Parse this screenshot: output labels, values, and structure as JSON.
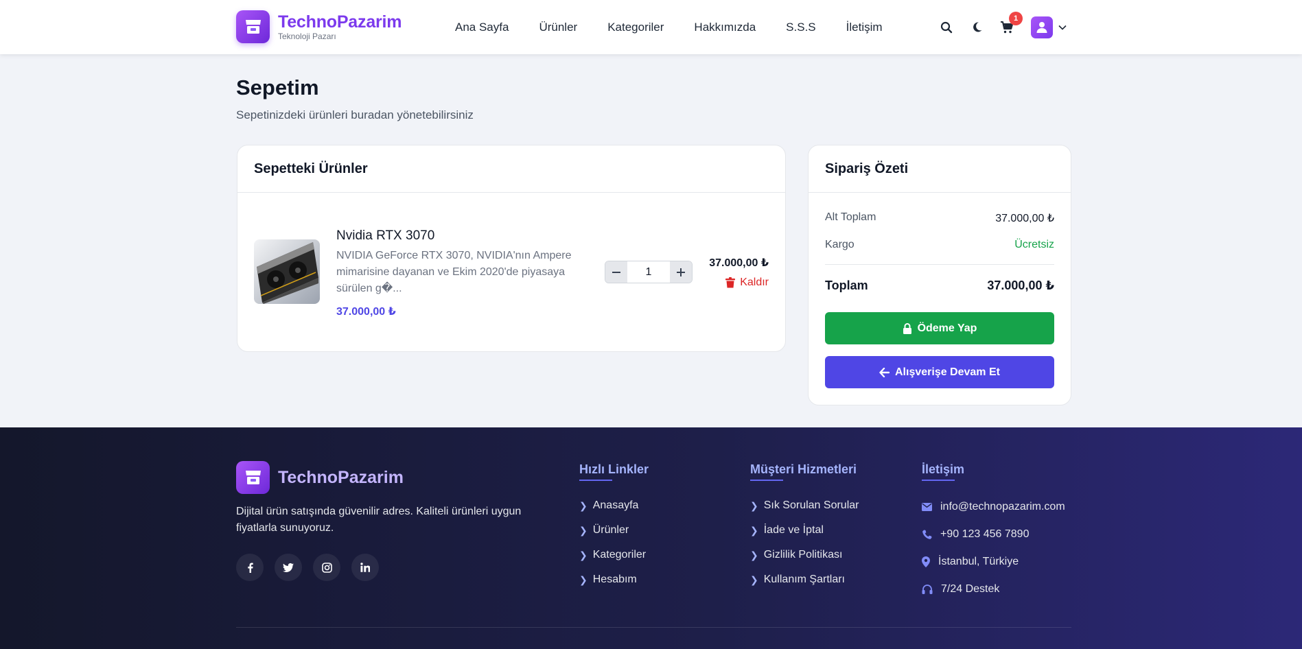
{
  "brand": {
    "name": "TechnoPazarim",
    "tagline": "Teknoloji Pazarı"
  },
  "nav": {
    "links": [
      "Ana Sayfa",
      "Ürünler",
      "Kategoriler",
      "Hakkımızda",
      "S.S.S",
      "İletişim"
    ],
    "cart_count": "1"
  },
  "page": {
    "title": "Sepetim",
    "subtitle": "Sepetinizdeki ürünleri buradan yönetebilirsiniz"
  },
  "cart": {
    "heading": "Sepetteki Ürünler",
    "items": [
      {
        "name": "Nvidia RTX 3070",
        "description": "NVIDIA GeForce RTX 3070, NVIDIA'nın Ampere mimarisine dayanan ve Ekim 2020'de piyasaya sürülen g�...",
        "price": "37.000,00 ₺",
        "quantity": "1",
        "line_total": "37.000,00 ₺",
        "remove_label": "Kaldır"
      }
    ]
  },
  "summary": {
    "heading": "Sipariş Özeti",
    "subtotal_label": "Alt Toplam",
    "subtotal_value": "37.000,00 ₺",
    "shipping_label": "Kargo",
    "shipping_value": "Ücretsiz",
    "total_label": "Toplam",
    "total_value": "37.000,00 ₺",
    "pay_button": "Ödeme Yap",
    "continue_button": "Alışverişe Devam Et"
  },
  "footer": {
    "brand_name": "TechnoPazarim",
    "description": "Dijital ürün satışında güvenilir adres. Kaliteli ürünleri uygun fiyatlarla sunuyoruz.",
    "quick_links": {
      "heading": "Hızlı Linkler",
      "items": [
        "Anasayfa",
        "Ürünler",
        "Kategoriler",
        "Hesabım"
      ]
    },
    "customer_service": {
      "heading": "Müşteri Hizmetleri",
      "items": [
        "Sık Sorulan Sorular",
        "İade ve İptal",
        "Gizlilik Politikası",
        "Kullanım Şartları"
      ]
    },
    "contact": {
      "heading": "İletişim",
      "email": "info@technopazarim.com",
      "phone": "+90 123 456 7890",
      "location": "İstanbul, Türkiye",
      "support": "7/24 Destek"
    }
  },
  "colors": {
    "brand": "#7c3aed",
    "accent": "#4f46e5",
    "success": "#16a34a",
    "danger": "#dc2626"
  }
}
